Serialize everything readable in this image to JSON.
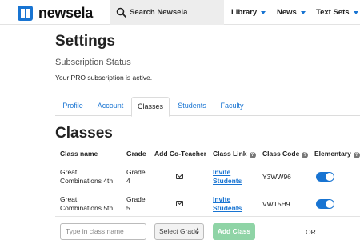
{
  "header": {
    "logo_text": "newsela",
    "search_placeholder": "Search Newsela",
    "nav": [
      {
        "label": "Library"
      },
      {
        "label": "News"
      },
      {
        "label": "Text Sets"
      }
    ]
  },
  "page": {
    "title": "Settings",
    "subscription_heading": "Subscription Status",
    "subscription_text": "Your PRO subscription is active.",
    "tabs": [
      {
        "label": "Profile",
        "active": false
      },
      {
        "label": "Account",
        "active": false
      },
      {
        "label": "Classes",
        "active": true
      },
      {
        "label": "Students",
        "active": false
      },
      {
        "label": "Faculty",
        "active": false
      }
    ],
    "section_title": "Classes"
  },
  "table": {
    "headers": {
      "class_name": "Class name",
      "grade": "Grade",
      "co_teacher": "Add Co-Teacher",
      "class_link": "Class Link",
      "class_code": "Class Code",
      "elementary": "Elementary"
    },
    "help_glyph": "?",
    "rows": [
      {
        "name_line1": "Great",
        "name_line2": "Combinations 4th",
        "grade_line1": "Grade",
        "grade_line2": "4",
        "link_line1": "Invite",
        "link_line2": "Students",
        "code": "Y3WW96",
        "elementary": true
      },
      {
        "name_line1": "Great",
        "name_line2": "Combinations 5th",
        "grade_line1": "Grade",
        "grade_line2": "5",
        "link_line1": "Invite",
        "link_line2": "Students",
        "code": "VWT5H9",
        "elementary": true
      }
    ]
  },
  "add_class": {
    "name_placeholder": "Type in class name",
    "grade_select": "Select Grade",
    "button_label": "Add Class",
    "or_text": "OR"
  },
  "colors": {
    "accent": "#1874d2",
    "add_button": "#8fd4a6"
  }
}
